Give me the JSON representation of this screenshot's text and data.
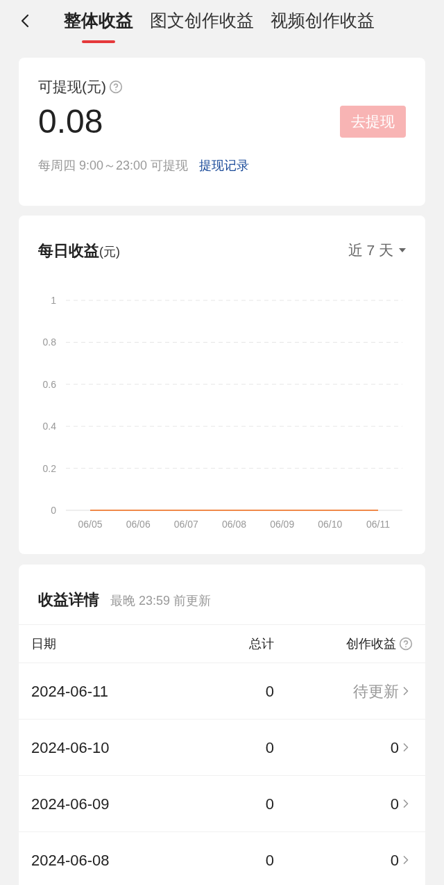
{
  "tabs": [
    {
      "label": "整体收益",
      "selected": true
    },
    {
      "label": "图文创作收益",
      "selected": false
    },
    {
      "label": "视频创作收益",
      "selected": false
    }
  ],
  "withdraw": {
    "label": "可提现(元)",
    "amount": "0.08",
    "button": "去提现",
    "disabled": true,
    "hint": "每周四 9:00～23:00 可提现",
    "link": "提现记录"
  },
  "daily": {
    "title": "每日收益",
    "unit": "(元)",
    "range": "近 7 天",
    "chart_data": {
      "type": "line",
      "categories": [
        "06/05",
        "06/06",
        "06/07",
        "06/08",
        "06/09",
        "06/10",
        "06/11"
      ],
      "series": [
        {
          "color": "#f0894a",
          "values": [
            0,
            0,
            0,
            0,
            0,
            0,
            0
          ]
        }
      ],
      "grid": true,
      "ylim": [
        0,
        1
      ],
      "yticks": [
        0,
        0.2,
        0.4,
        0.6,
        0.8,
        1
      ]
    }
  },
  "details": {
    "title": "收益详情",
    "note": "最晚 23:59 前更新",
    "columns": [
      "日期",
      "总计",
      "创作收益"
    ],
    "rows": [
      {
        "date": "2024-06-11",
        "total": "0",
        "creation": "待更新",
        "kind": "pending"
      },
      {
        "date": "2024-06-10",
        "total": "0",
        "creation": "0",
        "kind": "value"
      },
      {
        "date": "2024-06-09",
        "total": "0",
        "creation": "0",
        "kind": "value"
      },
      {
        "date": "2024-06-08",
        "total": "0",
        "creation": "0",
        "kind": "value"
      }
    ]
  }
}
